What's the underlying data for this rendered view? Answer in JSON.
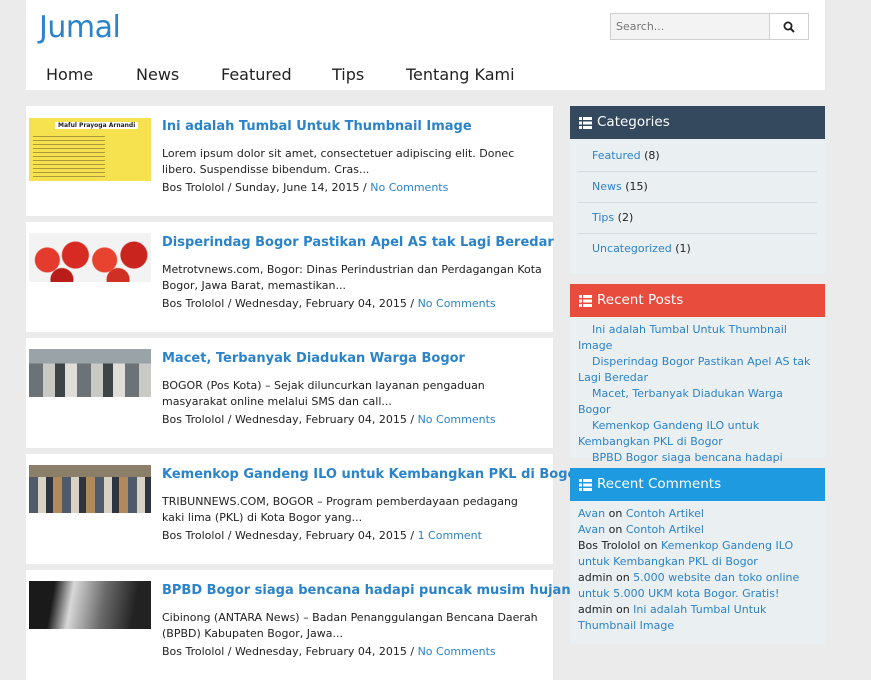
{
  "site": {
    "title": "Jumal"
  },
  "search": {
    "placeholder": "Search..."
  },
  "nav": [
    "Home",
    "News",
    "Featured",
    "Tips",
    "Tentang Kami"
  ],
  "posts": [
    {
      "title": "Ini adalah Tumbal Untuk Thumbnail Image",
      "excerpt": "Lorem ipsum dolor sit amet, consectetuer adipiscing elit. Donec libero. Suspendisse bibendum. Cras...",
      "author": "Bos Trololol",
      "date": "Sunday, June 14, 2015",
      "comments": "No Comments",
      "thumb_caption": "Maful Prayoga Arnandi"
    },
    {
      "title": "Disperindag Bogor Pastikan Apel AS tak Lagi Beredar",
      "excerpt": "Metrotvnews.com, Bogor: Dinas Perindustrian dan Perdagangan Kota Bogor, Jawa Barat, memastikan...",
      "author": "Bos Trololol",
      "date": "Wednesday, February 04, 2015",
      "comments": "No Comments"
    },
    {
      "title": "Macet, Terbanyak Diadukan Warga Bogor",
      "excerpt": "BOGOR (Pos Kota) – Sejak diluncurkan layanan pengaduan masyarakat online melalui SMS dan call...",
      "author": "Bos Trololol",
      "date": "Wednesday, February 04, 2015",
      "comments": "No Comments"
    },
    {
      "title": "Kemenkop Gandeng ILO untuk Kembangkan PKL di Bogor",
      "excerpt": "TRIBUNNEWS.COM, BOGOR – Program pemberdayaan pedagang kaki lima (PKL) di Kota Bogor yang...",
      "author": "Bos Trololol",
      "date": "Wednesday, February 04, 2015",
      "comments": "1 Comment"
    },
    {
      "title": "BPBD Bogor siaga bencana hadapi puncak musim hujan",
      "excerpt": "Cibinong (ANTARA News) – Badan Penanggulangan Bencana Daerah (BPBD) Kabupaten Bogor, Jawa...",
      "author": "Bos Trololol",
      "date": "Wednesday, February 04, 2015",
      "comments": "No Comments"
    }
  ],
  "sidebar": {
    "categories": {
      "title": "Categories",
      "color": "#34495e",
      "items": [
        {
          "name": "Featured",
          "count": "(8)"
        },
        {
          "name": "News",
          "count": "(15)"
        },
        {
          "name": "Tips",
          "count": "(2)"
        },
        {
          "name": "Uncategorized",
          "count": "(1)"
        }
      ]
    },
    "recent_posts": {
      "title": "Recent Posts",
      "color": "#e74c3c",
      "items": [
        "Ini adalah Tumbal Untuk Thumbnail Image",
        "Disperindag Bogor Pastikan Apel AS tak Lagi Beredar",
        "Macet, Terbanyak Diadukan Warga Bogor",
        "Kemenkop Gandeng ILO untuk Kembangkan PKL di Bogor",
        "BPBD Bogor siaga bencana hadapi puncak musim hujan"
      ]
    },
    "recent_comments": {
      "title": "Recent Comments",
      "color": "#1e9ae0",
      "on_word": "on",
      "items": [
        {
          "author": "Avan",
          "post": "Contoh Artikel"
        },
        {
          "author": "Avan",
          "post": "Contoh Artikel"
        },
        {
          "author": "Bos Trololol",
          "post": "Kemenkop Gandeng ILO untuk Kembangkan PKL di Bogor"
        },
        {
          "author": "admin",
          "post": "5.000 website dan toko online untuk 5.000 UKM kota Bogor. Gratis!"
        },
        {
          "author": "admin",
          "post": "Ini adalah Tumbal Untuk Thumbnail Image"
        }
      ]
    }
  },
  "colors": {
    "accent": "#2b83c9",
    "background": "#ebebeb"
  }
}
